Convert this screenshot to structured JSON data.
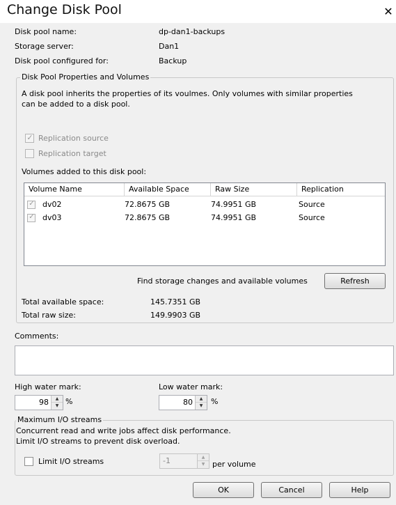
{
  "window": {
    "title": "Change Disk Pool",
    "close_glyph": "✕"
  },
  "info": {
    "disk_pool_name_label": "Disk pool name:",
    "disk_pool_name_value": "dp-dan1-backups",
    "storage_server_label": "Storage server:",
    "storage_server_value": "Dan1",
    "configured_for_label": "Disk pool configured for:",
    "configured_for_value": "Backup"
  },
  "properties": {
    "legend": "Disk Pool Properties and Volumes",
    "description_line1": "A disk pool inherits the properties of its voulmes. Only volumes with similar properties",
    "description_line2": "can be added to a disk pool.",
    "replication_source_label": "Replication source",
    "replication_source_checked": true,
    "replication_target_label": "Replication target",
    "replication_target_checked": false,
    "volumes_label": "Volumes added to this disk pool:",
    "columns": [
      "Volume Name",
      "Available Space",
      "Raw Size",
      "Replication"
    ],
    "volumes": [
      {
        "name": "dv02",
        "available": "72.8675 GB",
        "raw": "74.9951 GB",
        "replication": "Source",
        "checked": true
      },
      {
        "name": "dv03",
        "available": "72.8675 GB",
        "raw": "74.9951 GB",
        "replication": "Source",
        "checked": true
      }
    ],
    "find_changes_text": "Find storage changes and available volumes",
    "refresh_label": "Refresh",
    "total_available_label": "Total available space:",
    "total_available_value": "145.7351 GB",
    "total_raw_label": "Total raw size:",
    "total_raw_value": "149.9903 GB"
  },
  "comments": {
    "label": "Comments:",
    "value": ""
  },
  "water_marks": {
    "high_label": "High water mark:",
    "high_value": "98",
    "low_label": "Low water mark:",
    "low_value": "80",
    "unit": "%"
  },
  "io": {
    "legend": "Maximum I/O streams",
    "description_line1": "Concurrent read and write jobs affect disk performance.",
    "description_line2": "Limit I/O streams to prevent disk overload.",
    "limit_label": "Limit I/O streams",
    "limit_checked": false,
    "streams_value": "-1",
    "per_volume_label": "per volume"
  },
  "buttons": {
    "ok": "OK",
    "cancel": "Cancel",
    "help": "Help"
  },
  "icons": {
    "check": "✓",
    "spin_up": "▲",
    "spin_down": "▼"
  }
}
